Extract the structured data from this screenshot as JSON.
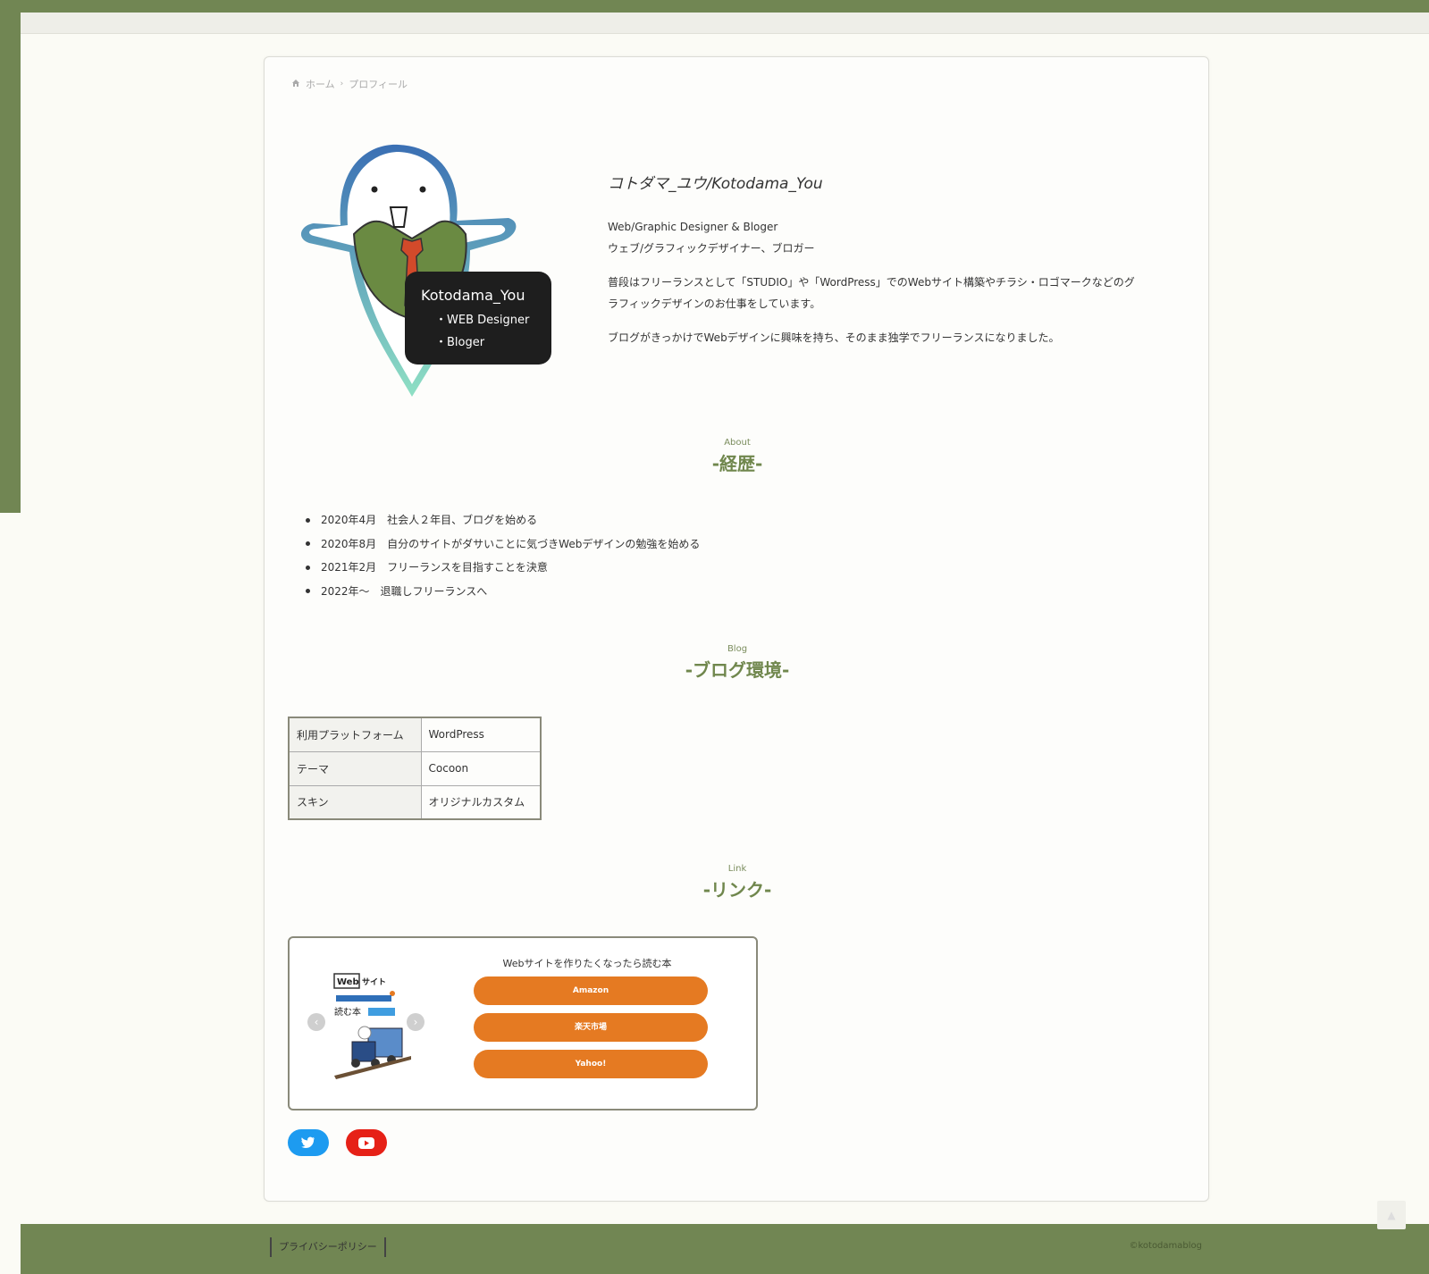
{
  "colors": {
    "accent": "#718653",
    "heading": "#70874d",
    "button": "#e57a22",
    "twitter": "#1d9bf0",
    "youtube": "#e62117"
  },
  "breadcrumb": {
    "home_icon": "home-icon",
    "home": "ホーム",
    "current": "プロフィール"
  },
  "profile": {
    "badge_name": "Kotodama_You",
    "badge_line1": "・WEB Designer",
    "badge_line2": "・Bloger",
    "name": "コトダマ_ユウ/Kotodama_You",
    "role_en": "Web/Graphic Designer & Bloger",
    "role_ja": "ウェブ/グラフィックデザイナー、ブロガー",
    "desc1": "普段はフリーランスとして「STUDIO」や「WordPress」でのWebサイト構築やチラシ・ロゴマークなどのグラフィックデザインのお仕事をしています。",
    "desc2": "ブログがきっかけでWebデザインに興味を持ち、そのまま独学でフリーランスになりました。"
  },
  "about": {
    "sub": "About",
    "title": "-経歴-",
    "items": [
      "2020年4月　社会人２年目、ブログを始める",
      "2020年8月　自分のサイトがダサいことに気づきWebデザインの勉強を始める",
      "2021年2月　フリーランスを目指すことを決意",
      "2022年～　退職しフリーランスへ"
    ]
  },
  "blog": {
    "sub": "Blog",
    "title": "-ブログ環境-",
    "rows": [
      {
        "key": "利用プラットフォーム",
        "value": "WordPress"
      },
      {
        "key": "テーマ",
        "value": "Cocoon"
      },
      {
        "key": "スキン",
        "value": "オリジナルカスタム"
      }
    ]
  },
  "link": {
    "sub": "Link",
    "title": "-リンク-",
    "book": {
      "title": "Webサイトを作りたくなったら読む本",
      "cover_text1": "Web",
      "cover_text2": "サイト",
      "cover_text3": "読む本",
      "prev_icon": "chevron-left-icon",
      "next_icon": "chevron-right-icon",
      "buttons": [
        "Amazon",
        "楽天市場",
        "Yahoo!"
      ]
    },
    "social": [
      "twitter-icon",
      "youtube-icon"
    ]
  },
  "footer": {
    "privacy": "プライバシーポリシー",
    "copyright": "©kotodamablog"
  },
  "scroll_top_icon": "arrow-up-icon"
}
